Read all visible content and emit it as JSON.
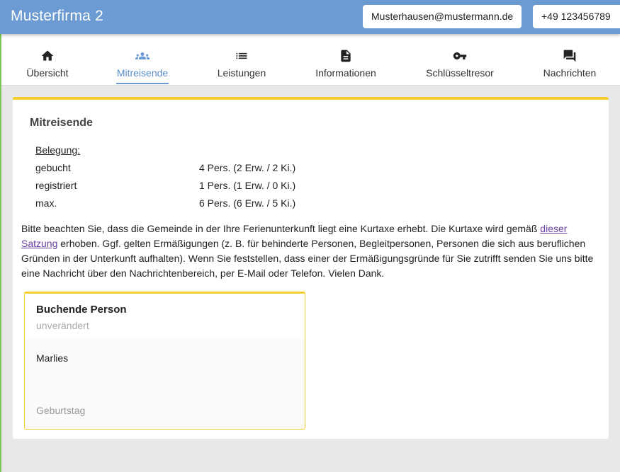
{
  "header": {
    "brand": "Musterfirma 2",
    "email": "Musterhausen@mustermann.de",
    "phone": "+49 123456789"
  },
  "nav": {
    "active": "Mitreisende",
    "tabs": [
      {
        "label": "Übersicht",
        "icon": "home-icon"
      },
      {
        "label": "Mitreisende",
        "icon": "group-icon"
      },
      {
        "label": "Leistungen",
        "icon": "list-icon"
      },
      {
        "label": "Informationen",
        "icon": "document-icon"
      },
      {
        "label": "Schlüsseltresor",
        "icon": "key-icon"
      },
      {
        "label": "Nachrichten",
        "icon": "chat-icon"
      }
    ]
  },
  "colors": {
    "header": "#6b9bd2",
    "accent_yellow": "#f5cd2e",
    "active_tab": "#5b8dc9",
    "link": "#6a3fa0",
    "side_line": "#7cc35a"
  },
  "section": {
    "title": "Mitreisende",
    "belegung_heading": "Belegung:",
    "rows": [
      {
        "label": "gebucht",
        "value": "4 Pers. (2 Erw. / 2 Ki.)"
      },
      {
        "label": "registriert",
        "value": "1 Pers. (1 Erw. / 0 Ki.)"
      },
      {
        "label": "max.",
        "value": "6 Pers. (6 Erw. / 5 Ki.)"
      }
    ],
    "notice_before": "Bitte beachten Sie, dass die Gemeinde in der Ihre Ferienunterkunft liegt eine Kurtaxe erhebt. Die Kurtaxe wird gemäß ",
    "notice_link": "dieser Satzung",
    "notice_after": " erhoben. Ggf. gelten Ermäßigungen (z. B. für behinderte Personen, Begleitpersonen, Personen die sich aus beruflichen Gründen in der Unterkunft aufhalten). Wenn Sie feststellen, dass einer der Ermäßigungsgründe für Sie zutrifft senden Sie uns bitte eine Nachricht über den Nachrichtenbereich, per E-Mail oder Telefon. Vielen Dank."
  },
  "person": {
    "role": "Buchende Person",
    "status": "unverändert",
    "first_name": "Marlies",
    "birthday_label": "Geburtstag"
  }
}
